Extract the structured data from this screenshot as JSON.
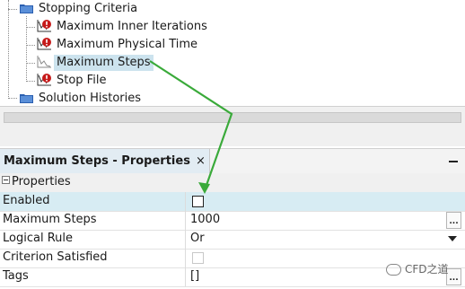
{
  "tree": {
    "folders": [
      {
        "label": "Stopping Criteria"
      },
      {
        "label": "Solution Histories"
      }
    ],
    "items": [
      {
        "label": "Maximum Inner Iterations",
        "icon": "criterion-warning-icon"
      },
      {
        "label": "Maximum Physical Time",
        "icon": "criterion-warning-icon"
      },
      {
        "label": "Maximum Steps",
        "icon": "criterion-chart-icon",
        "selected": true
      },
      {
        "label": "Stop File",
        "icon": "criterion-warning-icon"
      }
    ]
  },
  "properties": {
    "tab_title": "Maximum Steps - Properties",
    "tab_close": "×",
    "section_label": "Properties",
    "rows": [
      {
        "name": "Enabled",
        "value": "",
        "editor": "checkbox"
      },
      {
        "name": "Maximum Steps",
        "value": "1000",
        "editor": "ellipsis"
      },
      {
        "name": "Logical Rule",
        "value": "Or",
        "editor": "dropdown"
      },
      {
        "name": "Criterion Satisfied",
        "value": "",
        "editor": "checkbox-disabled"
      },
      {
        "name": "Tags",
        "value": "[]",
        "editor": "ellipsis"
      }
    ],
    "ellipsis": "..."
  },
  "watermark": {
    "text": "CFD之道"
  },
  "colors": {
    "folder": "#2b5fb0",
    "warning_red": "#c61a1a",
    "annotation_arrow": "#3aaa3a",
    "selection": "#cce3ee"
  }
}
